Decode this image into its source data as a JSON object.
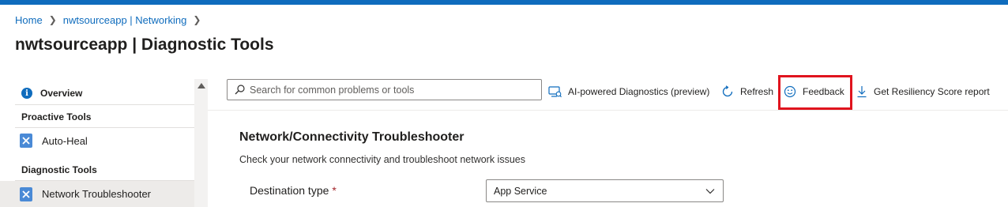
{
  "breadcrumb": {
    "items": [
      "Home",
      "nwtsourceapp | Networking"
    ]
  },
  "page": {
    "title": "nwtsourceapp | Diagnostic Tools"
  },
  "sidebar": {
    "overview": "Overview",
    "sections": [
      {
        "title": "Proactive Tools",
        "items": [
          "Auto-Heal"
        ]
      },
      {
        "title": "Diagnostic Tools",
        "items": [
          "Network Troubleshooter"
        ]
      }
    ],
    "selected_item": "Network Troubleshooter"
  },
  "toolbar": {
    "search_placeholder": "Search for common problems or tools",
    "ai_diagnostics": "AI-powered Diagnostics (preview)",
    "refresh": "Refresh",
    "feedback": "Feedback",
    "resiliency": "Get Resiliency Score report",
    "highlighted_button": "Feedback"
  },
  "main": {
    "title": "Network/Connectivity Troubleshooter",
    "description": "Check your network connectivity and troubleshoot network issues",
    "destination_label": "Destination type",
    "required_marker": "*",
    "destination_value": "App Service"
  },
  "colors": {
    "accent": "#0f6cbd",
    "highlight": "#e0141e",
    "required": "#a4262c"
  },
  "icons": [
    "info-icon",
    "tool-icon",
    "search-icon",
    "ai-diagnostics-icon",
    "refresh-icon",
    "smiley-icon",
    "download-icon",
    "chevron-down-icon",
    "chevron-right-icon",
    "scroll-up-icon"
  ]
}
